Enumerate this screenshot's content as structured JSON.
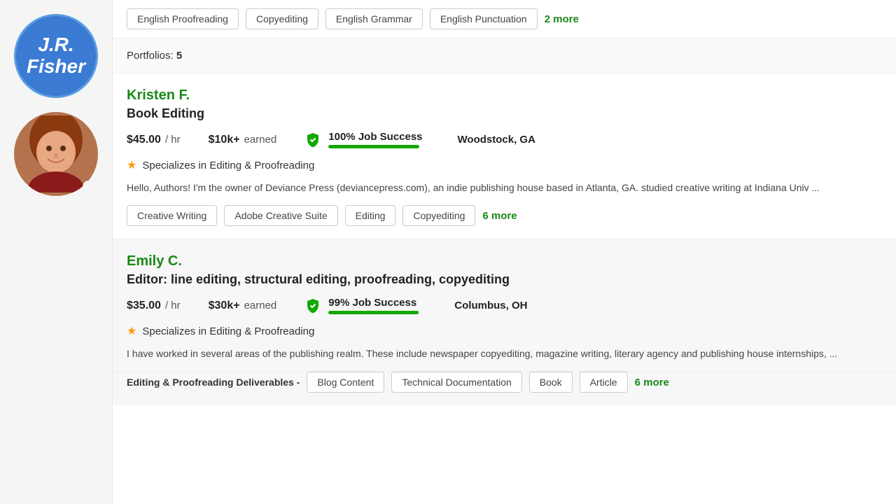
{
  "topSkills": {
    "tags": [
      "English Proofreading",
      "Copyediting",
      "English Grammar",
      "English Punctuation"
    ],
    "moreLabel": "2 more"
  },
  "portfolios": {
    "label": "Portfolios:",
    "count": "5"
  },
  "freelancers": [
    {
      "id": "kristen",
      "name": "Kristen F.",
      "title": "Book Editing",
      "rate": "$45.00",
      "rateUnit": "/ hr",
      "earned": "$10k+",
      "earnedLabel": "earned",
      "jobSuccessPercent": "100%",
      "jobSuccessLabel": "100% Job Success",
      "jobSuccessFill": 100,
      "location": "Woodstock, GA",
      "specialization": "Specializes in Editing & Proofreading",
      "description": "Hello, Authors! I'm the owner of Deviance Press (deviancepress.com), an indie publishing house based in Atlanta, GA. studied creative writing at Indiana Univ ...",
      "skills": [
        "Creative Writing",
        "Adobe Creative Suite",
        "Editing",
        "Copyediting"
      ],
      "moreSkillsLabel": "6 more",
      "bg": "#d4886a"
    },
    {
      "id": "emily",
      "name": "Emily C.",
      "title": "Editor: line editing, structural editing, proofreading, copyediting",
      "rate": "$35.00",
      "rateUnit": "/ hr",
      "earned": "$30k+",
      "earnedLabel": "earned",
      "jobSuccessPercent": "99%",
      "jobSuccessLabel": "99% Job Success",
      "jobSuccessFill": 99,
      "location": "Columbus, OH",
      "specialization": "Specializes in Editing & Proofreading",
      "description": "I have worked in several areas of the publishing realm. These include newspaper copyediting, magazine writing, literary agency and publishing house internships, ...",
      "deliverables": {
        "label": "Editing & Proofreading Deliverables -",
        "tags": [
          "Blog Content",
          "Technical Documentation",
          "Book",
          "Article"
        ],
        "moreLabel": "6 more"
      },
      "bg": "#8b5a3c"
    }
  ]
}
